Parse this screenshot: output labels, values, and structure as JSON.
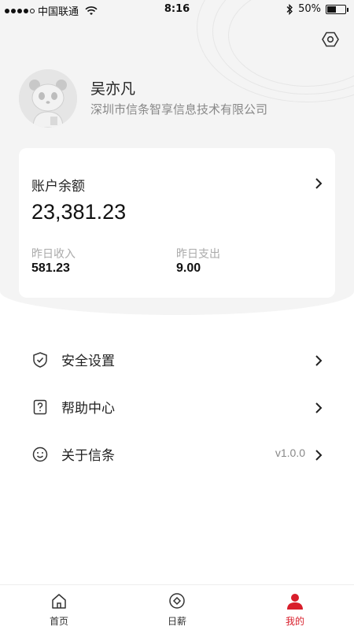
{
  "status_bar": {
    "carrier": "中国联通",
    "time": "8:16",
    "battery": "50%",
    "battery_level": 0.5
  },
  "profile": {
    "name": "吴亦凡",
    "company": "深圳市信条智享信息技术有限公司"
  },
  "balance_card": {
    "title": "账户余额",
    "balance": "23,381.23",
    "income_label": "昨日收入",
    "income_value": "581.23",
    "expense_label": "昨日支出",
    "expense_value": "9.00"
  },
  "menu": [
    {
      "label": "安全设置",
      "icon": "shield-check-icon"
    },
    {
      "label": "帮助中心",
      "icon": "help-icon"
    },
    {
      "label": "关于信条",
      "icon": "smile-icon",
      "version": "v1.0.0"
    }
  ],
  "tabs": [
    {
      "label": "首页",
      "icon": "home-icon",
      "active": false
    },
    {
      "label": "日薪",
      "icon": "coin-icon",
      "active": false
    },
    {
      "label": "我的",
      "icon": "user-icon",
      "active": true
    }
  ],
  "colors": {
    "accent": "#d81e2b",
    "background": "#f4f4f4"
  }
}
